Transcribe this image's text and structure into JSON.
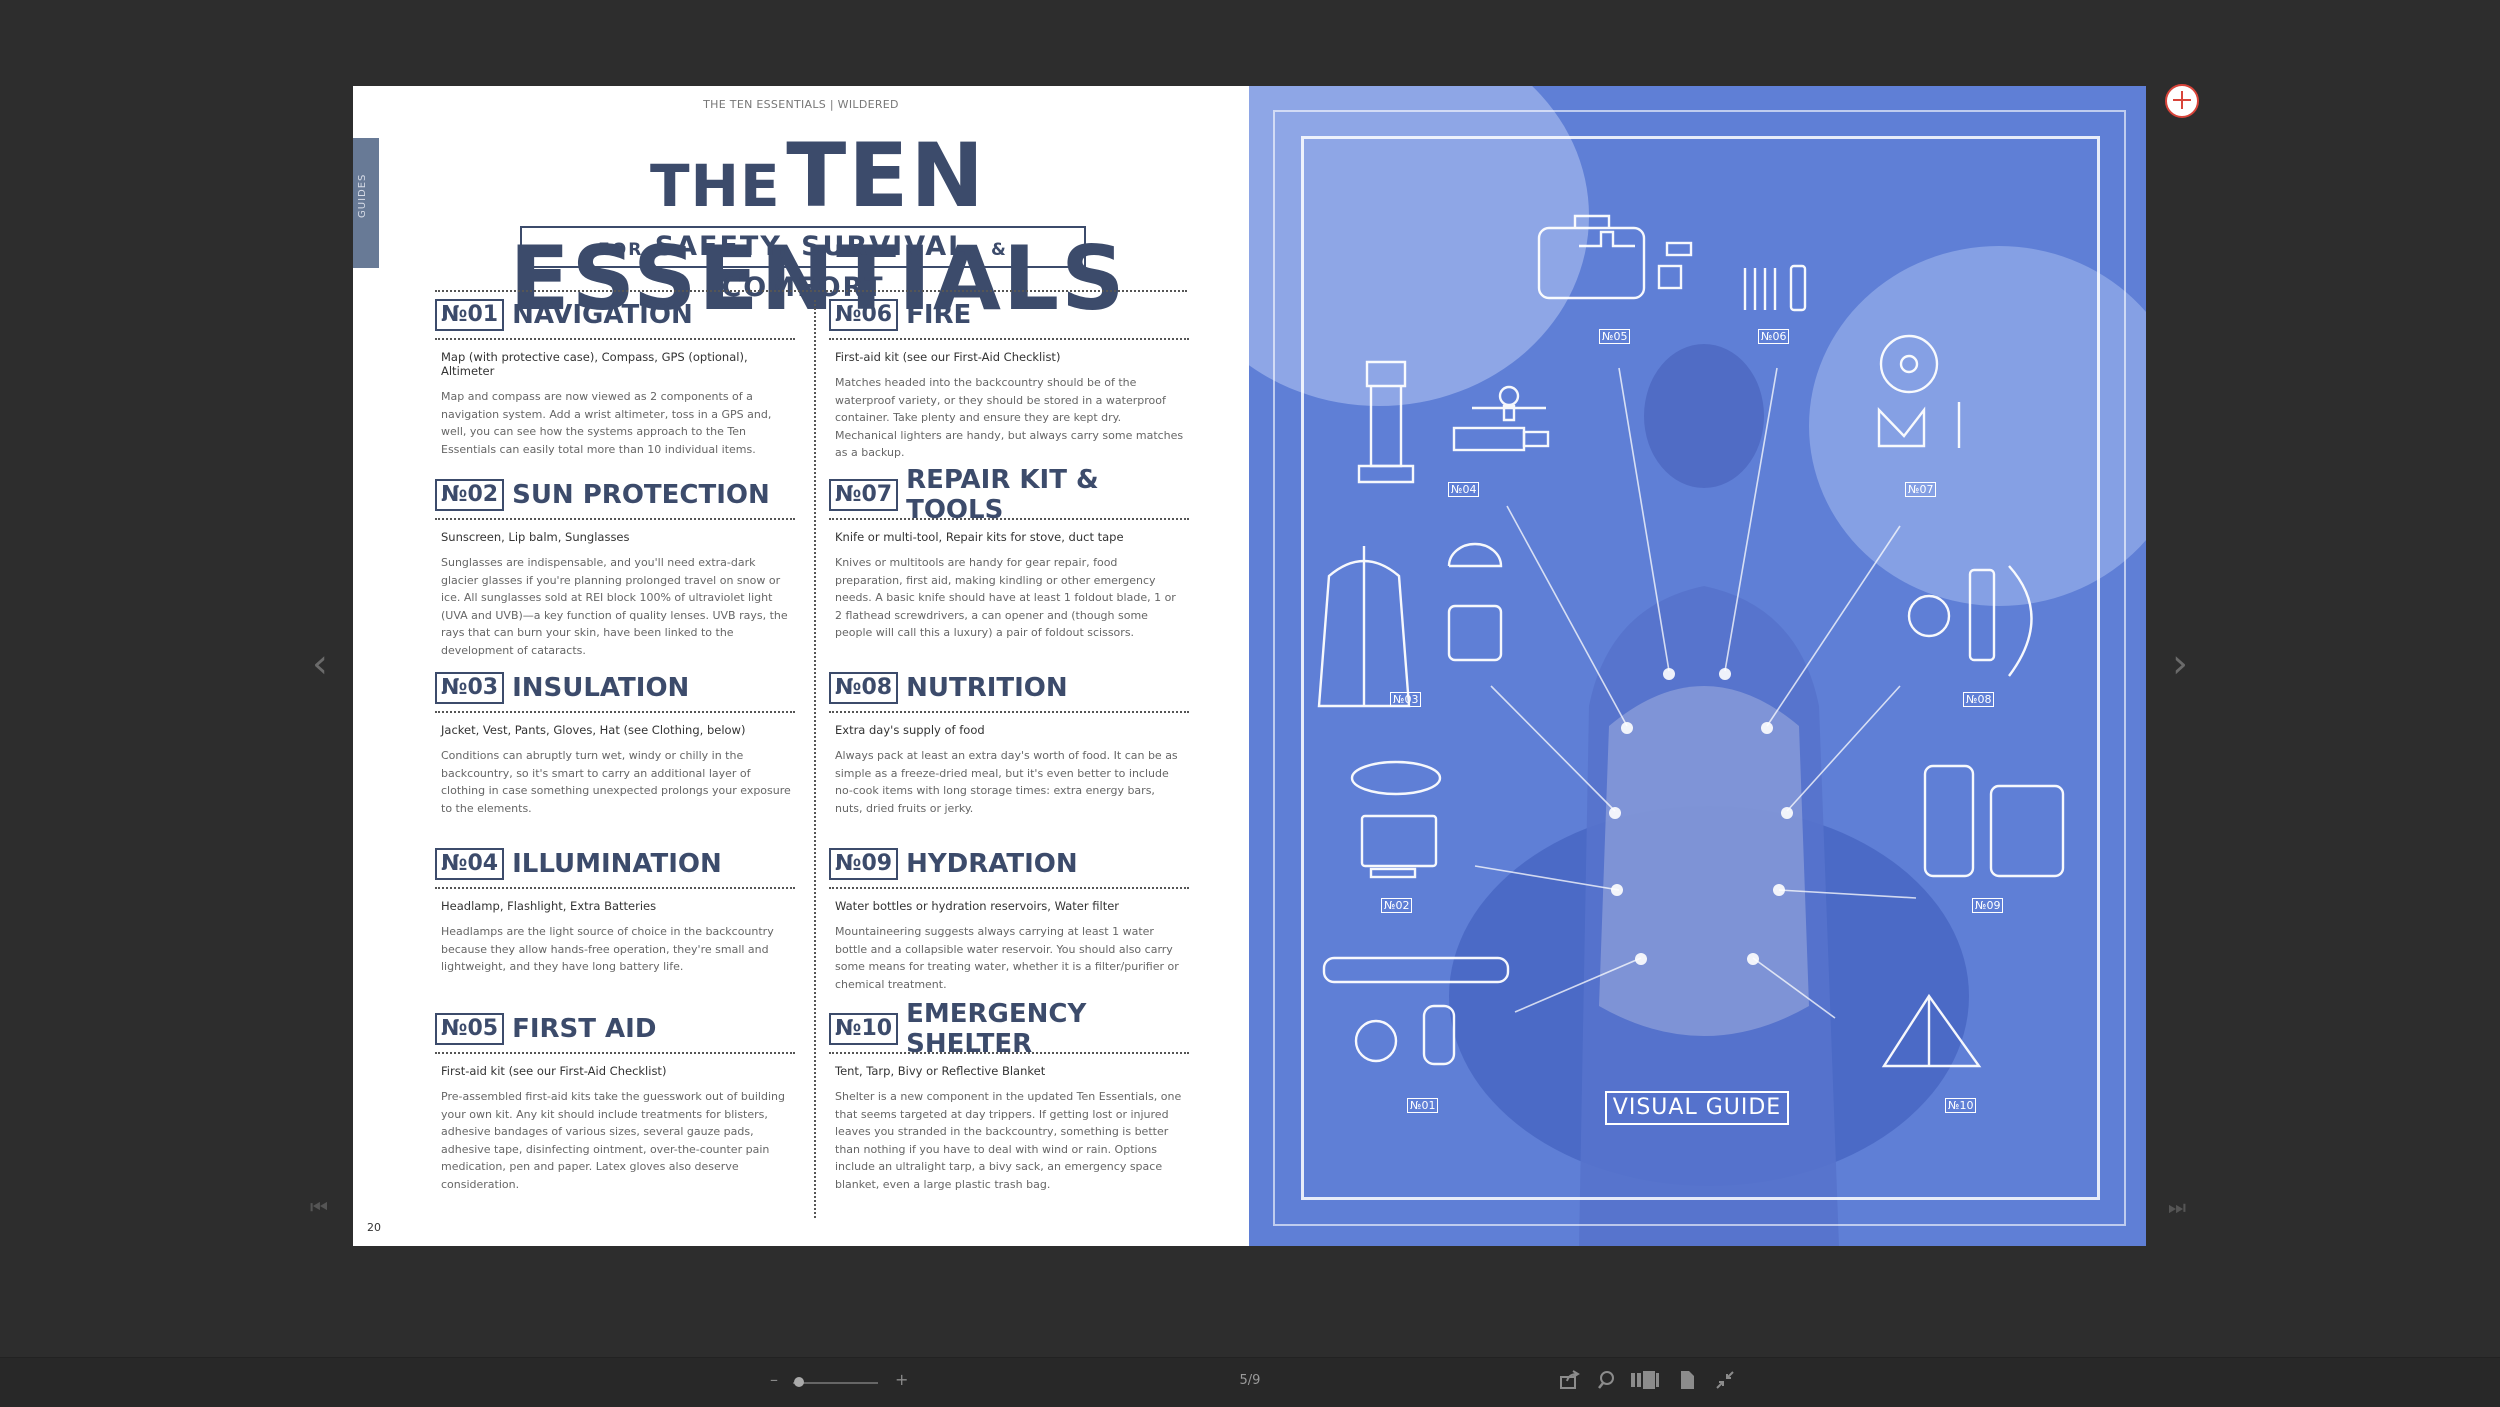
{
  "header": "THE TEN ESSENTIALS | WILDERED",
  "side_tab": "GUIDES",
  "title": {
    "the": "THE",
    "main": "TEN ESSENTIALS"
  },
  "subtitle": {
    "for": "FOR",
    "safety": "SAFETY,",
    "survival": "SURVIVAL,",
    "amp": "&",
    "comfort": "COMFORT"
  },
  "sections": [
    {
      "num": "№01",
      "title": "NAVIGATION",
      "items": "Map (with protective case), Compass, GPS (optional), Altimeter",
      "desc": "Map and compass are now viewed as 2 components of a navigation system. Add a wrist altimeter, toss in a GPS and, well, you can see how the systems approach to the Ten Essentials can easily total more than 10 individual items."
    },
    {
      "num": "№02",
      "title": "SUN PROTECTION",
      "items": "Sunscreen, Lip balm, Sunglasses",
      "desc": "Sunglasses are indispensable, and you'll need extra-dark glacier glasses if you're planning prolonged travel on snow or ice. All sunglasses sold at REI block 100% of ultraviolet light (UVA and UVB)—a key function of quality lenses. UVB rays, the rays that can burn your skin, have been linked to the development of cataracts."
    },
    {
      "num": "№03",
      "title": "INSULATION",
      "items": "Jacket, Vest, Pants, Gloves, Hat (see Clothing, below)",
      "desc": "Conditions can abruptly turn wet, windy or chilly in the backcountry, so it's smart to carry an additional layer of clothing in case something unexpected prolongs your exposure to the elements."
    },
    {
      "num": "№04",
      "title": "ILLUMINATION",
      "items": "Headlamp, Flashlight, Extra Batteries",
      "desc": "Headlamps are the light source of choice in the backcountry because they allow hands-free operation, they're small and lightweight, and they have long battery life."
    },
    {
      "num": "№05",
      "title": "FIRST AID",
      "items": "First-aid kit (see our First-Aid Checklist)",
      "desc": "Pre-assembled first-aid kits take the guesswork out of building your own kit. Any kit should include treatments for blisters, adhesive bandages of various sizes, several gauze pads, adhesive tape, disinfecting ointment, over-the-counter pain medication, pen and paper. Latex gloves also deserve consideration."
    },
    {
      "num": "№06",
      "title": "FIRE",
      "items": "First-aid kit (see our First-Aid Checklist)",
      "desc": "Matches headed into the backcountry should be of the waterproof variety, or they should be stored in a waterproof container. Take plenty and ensure they are kept dry. Mechanical lighters are handy, but always carry some matches as a backup."
    },
    {
      "num": "№07",
      "title": "REPAIR KIT & TOOLS",
      "items": "Knife or multi-tool, Repair kits for stove, duct tape",
      "desc": "Knives or multitools are handy for gear repair, food preparation, first aid, making kindling or other emergency needs. A basic knife should have at least 1 foldout blade, 1 or 2 flathead screwdrivers, a can opener and (though some people will call this a luxury) a pair of foldout scissors."
    },
    {
      "num": "№08",
      "title": "NUTRITION",
      "items": "Extra day's supply of food",
      "desc": "Always pack at least an extra day's worth of food. It can be as simple as a freeze-dried meal, but it's even better to include no-cook items with long storage times: extra energy bars, nuts, dried fruits or jerky."
    },
    {
      "num": "№09",
      "title": "HYDRATION",
      "items": "Water bottles or hydration reservoirs, Water filter",
      "desc": "Mountaineering suggests always carrying at least 1 water bottle and a collapsible water reservoir. You should also carry some means for treating water, whether it is a filter/purifier or chemical treatment."
    },
    {
      "num": "№10",
      "title": "EMERGENCY SHELTER",
      "items": "Tent, Tarp, Bivy or Reflective Blanket",
      "desc": "Shelter is a new component in the updated Ten Essentials, one that seems targeted at day trippers. If getting lost or injured leaves you stranded in the backcountry, something is better than nothing if you have to deal with wind or rain. Options include an ultralight tarp, a bivy sack, an emergency space blanket, even a large plastic trash bag."
    }
  ],
  "page_number": "20",
  "visual": {
    "label": "VISUAL GUIDE",
    "icon_nums": [
      "№05",
      "№06",
      "№04",
      "№07",
      "№03",
      "№08",
      "№02",
      "№09",
      "№01",
      "№10"
    ]
  },
  "toolbar": {
    "zoom_minus": "–",
    "zoom_plus": "+",
    "pager": "5/9",
    "zoom_level": 0.02
  },
  "nav": {
    "prev": "‹",
    "next": "›",
    "first": "⏮",
    "last": "⏭"
  },
  "colors": {
    "accent": "#3c4b6b",
    "visual_bg": "#5f7fd6",
    "toolbar_bg": "#282828"
  },
  "icons": [
    "plus-circle-icon",
    "share-icon",
    "search-icon",
    "thumbnails-icon",
    "single-page-icon",
    "exit-fullscreen-icon"
  ]
}
